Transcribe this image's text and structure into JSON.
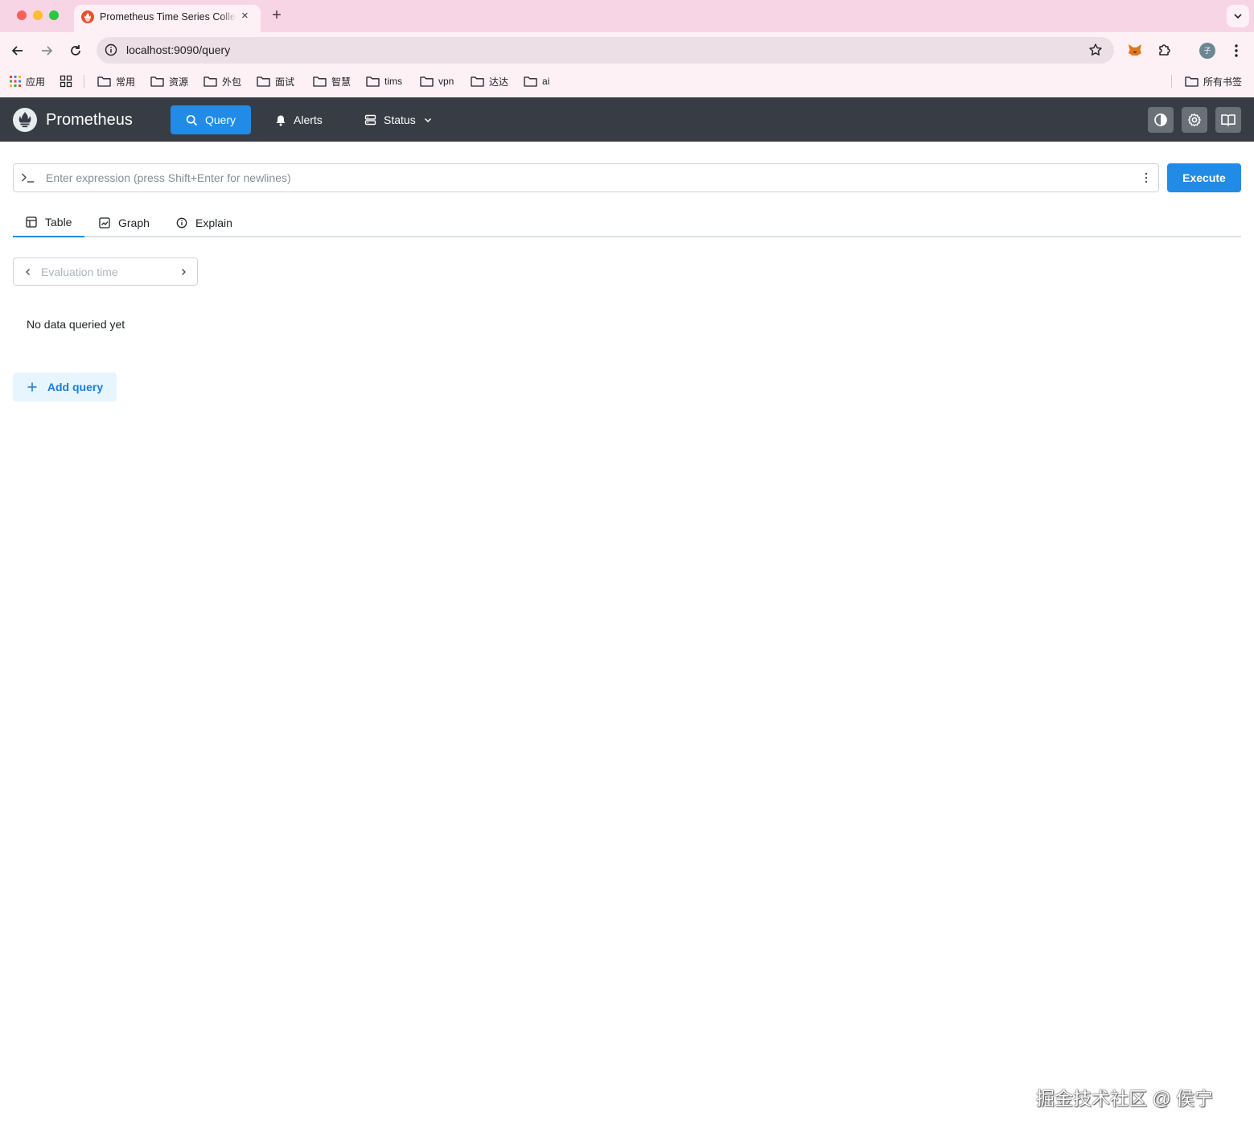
{
  "browser": {
    "tab_title": "Prometheus Time Series Collection and Processing Server",
    "tab_close": "×",
    "new_tab": "+",
    "url": "localhost:9090/query",
    "profile_initial": "子",
    "bookmarks": [
      {
        "label": "应用",
        "icon": "apps-grid-icon"
      },
      {
        "label": "",
        "icon": "tab-groups-icon"
      },
      {
        "label": "常用",
        "icon": "folder-icon"
      },
      {
        "label": "资源",
        "icon": "folder-icon"
      },
      {
        "label": "外包",
        "icon": "folder-icon"
      },
      {
        "label": "面试",
        "icon": "folder-icon"
      },
      {
        "label": "智慧",
        "icon": "folder-icon"
      },
      {
        "label": "tims",
        "icon": "folder-icon"
      },
      {
        "label": "vpn",
        "icon": "folder-icon"
      },
      {
        "label": "达达",
        "icon": "folder-icon"
      },
      {
        "label": "ai",
        "icon": "folder-icon"
      }
    ],
    "all_bookmarks": "所有书签"
  },
  "app": {
    "brand": "Prometheus",
    "nav": {
      "query": "Query",
      "alerts": "Alerts",
      "status": "Status"
    },
    "expression": {
      "placeholder": "Enter expression (press Shift+Enter for newlines)",
      "value": ""
    },
    "execute": "Execute",
    "tabs": [
      {
        "label": "Table",
        "icon": "table-icon",
        "active": true
      },
      {
        "label": "Graph",
        "icon": "graph-icon",
        "active": false
      },
      {
        "label": "Explain",
        "icon": "info-icon",
        "active": false
      }
    ],
    "evaluation_time": {
      "placeholder": "Evaluation time",
      "value": ""
    },
    "empty_message": "No data queried yet",
    "add_query": "Add query"
  },
  "watermark": "掘金技术社区 @ 侯宁",
  "colors": {
    "accent": "#228be6",
    "navbar": "#383d45",
    "tabstrip": "#f8d5e5",
    "toolbar": "#fdf1f6"
  }
}
